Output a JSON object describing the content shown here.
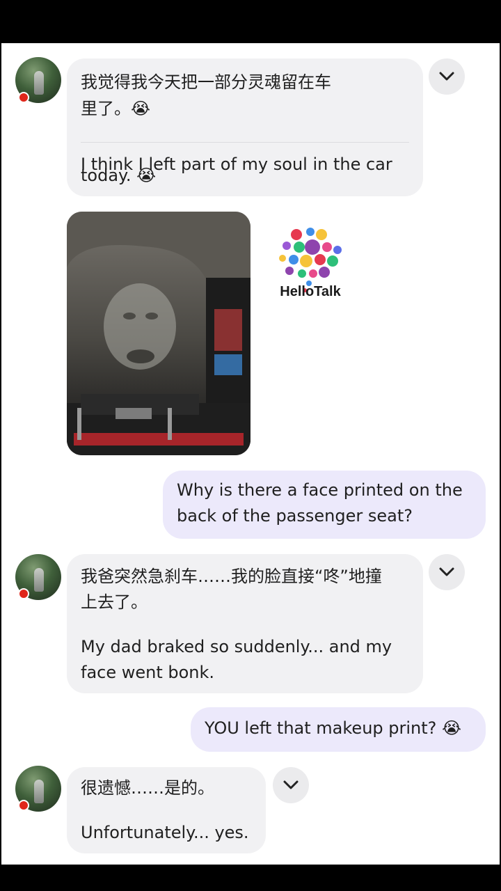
{
  "messages": [
    {
      "direction": "incoming",
      "original_line1": "我觉得我今天把一部分灵魂留在车",
      "original_line2": "里了。",
      "translation_line1": "I think I left part of my soul in the car",
      "translation_line2": "today."
    },
    {
      "direction": "incoming",
      "type": "image",
      "logo_text": "HelloTalk"
    },
    {
      "direction": "outgoing",
      "line1": "Why is there a face printed on the",
      "line2": "back of the passenger seat?"
    },
    {
      "direction": "incoming",
      "original_line1": "我爸突然急刹车……我的脸直接“咚”地撞",
      "original_line2": "上去了。",
      "translation_line1": "My dad braked so suddenly... and my",
      "translation_line2": "face went bonk."
    },
    {
      "direction": "outgoing",
      "line1": "YOU left that makeup print?"
    },
    {
      "direction": "incoming",
      "original_line1": "很遗憾……是的。",
      "translation_line1": "Unfortunately... yes."
    }
  ],
  "emoji": "😭",
  "colors": {
    "incoming_bubble": "#f1f1f3",
    "outgoing_bubble": "#ece9fb",
    "flag": "#e0261b"
  }
}
